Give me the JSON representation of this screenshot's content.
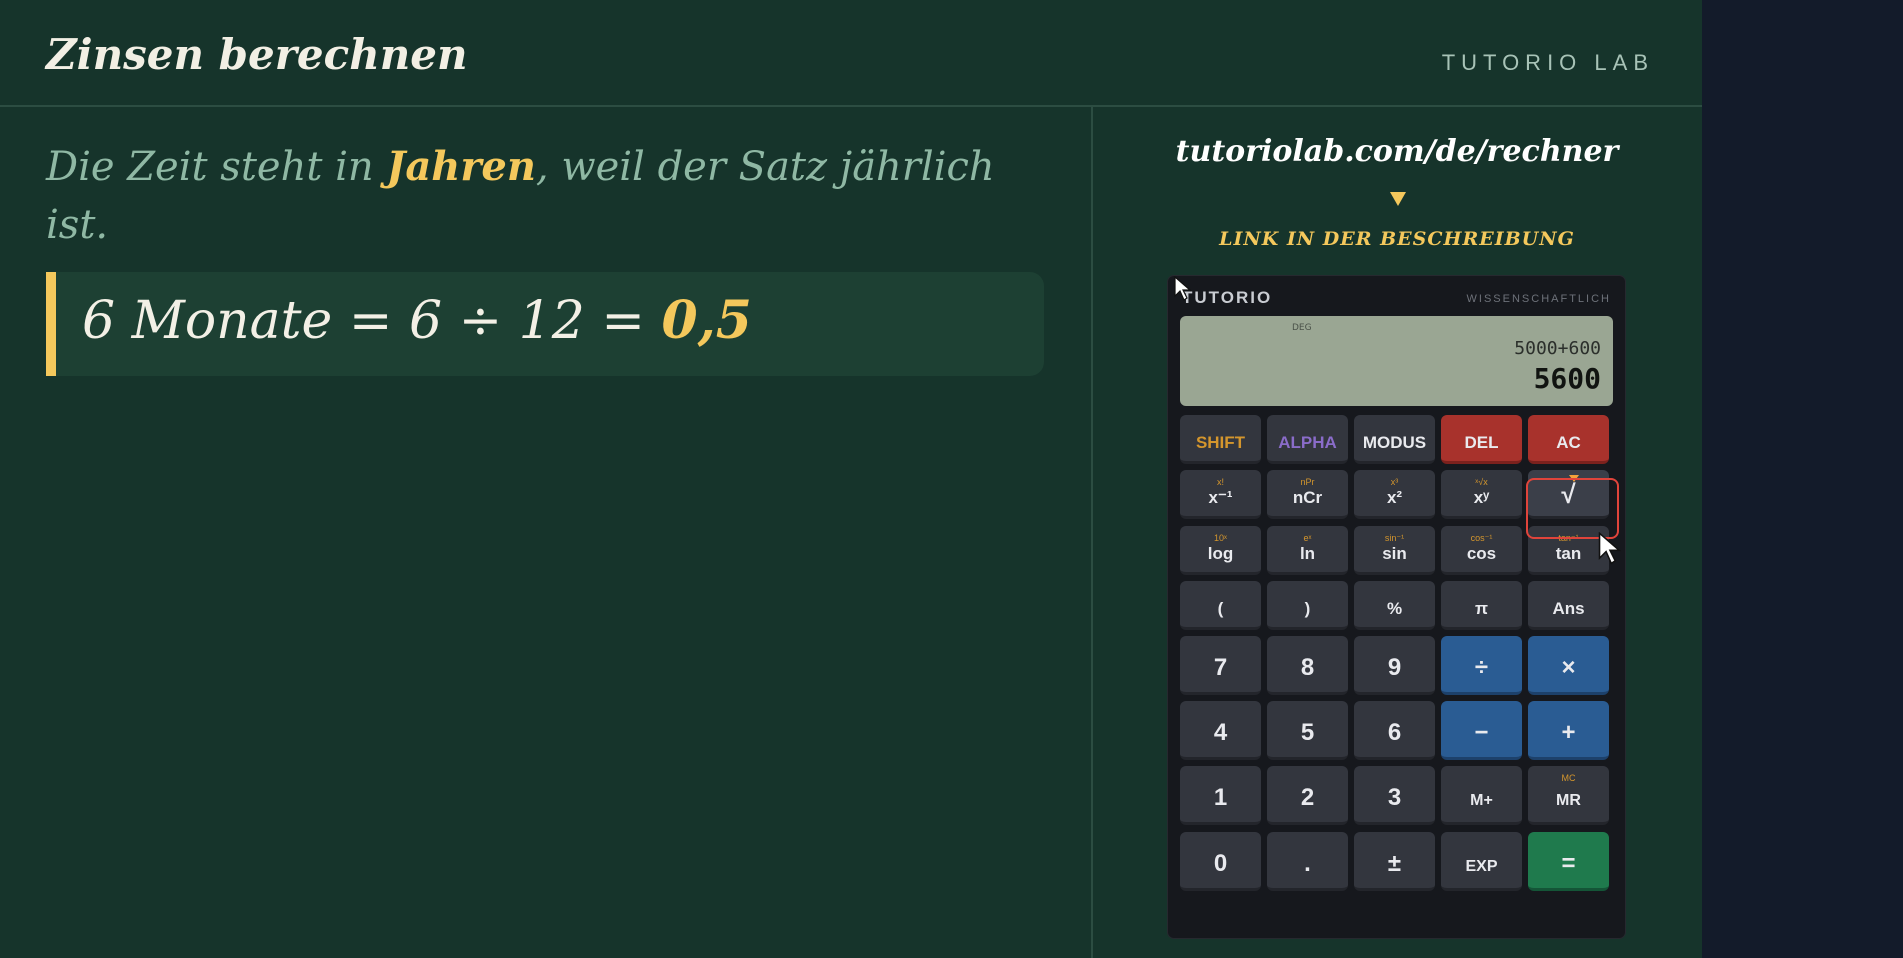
{
  "header": {
    "title": "Zinsen berechnen",
    "brand": "TUTORIO LAB"
  },
  "lesson": {
    "sentence_before": "Die Zeit steht in ",
    "sentence_highlight": "Jahren",
    "sentence_after": ", weil der Satz jährlich ist.",
    "formula": "6 Monate = 6 ÷ 12 = ",
    "formula_result": "0,5"
  },
  "promo": {
    "url": "tutoriolab.com/de/rechner",
    "link_text": "LINK IN DER BESCHREIBUNG"
  },
  "calculator": {
    "brand": "TUTORIO",
    "mode": "WISSENSCHAFTLICH",
    "display": {
      "angle_mode": "DEG",
      "expression": "5000+600",
      "result": "5600"
    },
    "rows": [
      [
        {
          "label": "SHIFT",
          "secondary": ""
        },
        {
          "label": "ALPHA",
          "secondary": ""
        },
        {
          "label": "MODUS",
          "secondary": ""
        },
        {
          "label": "DEL",
          "secondary": ""
        },
        {
          "label": "AC",
          "secondary": ""
        }
      ],
      [
        {
          "label": "x⁻¹",
          "secondary": "x!"
        },
        {
          "label": "nCr",
          "secondary": "nPr"
        },
        {
          "label": "x²",
          "secondary": "x³"
        },
        {
          "label": "xʸ",
          "secondary": "ˣ√x"
        },
        {
          "label": "√",
          "secondary": ""
        }
      ],
      [
        {
          "label": "log",
          "secondary": "10ˣ"
        },
        {
          "label": "ln",
          "secondary": "eˣ"
        },
        {
          "label": "sin",
          "secondary": "sin⁻¹"
        },
        {
          "label": "cos",
          "secondary": "cos⁻¹"
        },
        {
          "label": "tan",
          "secondary": "tan⁻¹"
        }
      ],
      [
        {
          "label": "(",
          "secondary": ""
        },
        {
          "label": ")",
          "secondary": ""
        },
        {
          "label": "%",
          "secondary": ""
        },
        {
          "label": "π",
          "secondary": ""
        },
        {
          "label": "Ans",
          "secondary": ""
        }
      ],
      [
        {
          "label": "7",
          "secondary": ""
        },
        {
          "label": "8",
          "secondary": ""
        },
        {
          "label": "9",
          "secondary": ""
        },
        {
          "label": "÷",
          "secondary": ""
        },
        {
          "label": "×",
          "secondary": ""
        }
      ],
      [
        {
          "label": "4",
          "secondary": ""
        },
        {
          "label": "5",
          "secondary": ""
        },
        {
          "label": "6",
          "secondary": ""
        },
        {
          "label": "−",
          "secondary": ""
        },
        {
          "label": "+",
          "secondary": ""
        }
      ],
      [
        {
          "label": "1",
          "secondary": ""
        },
        {
          "label": "2",
          "secondary": ""
        },
        {
          "label": "3",
          "secondary": ""
        },
        {
          "label": "M+",
          "secondary": ""
        },
        {
          "label": "MR",
          "secondary": "MC"
        }
      ],
      [
        {
          "label": "0",
          "secondary": ""
        },
        {
          "label": ".",
          "secondary": ""
        },
        {
          "label": "±",
          "secondary": ""
        },
        {
          "label": "EXP",
          "secondary": ""
        },
        {
          "label": "=",
          "secondary": ""
        }
      ]
    ],
    "highlighted_key": "√"
  },
  "colors": {
    "board": "#16342b",
    "accent": "#f4c85c",
    "highlight": "#e0443b"
  }
}
